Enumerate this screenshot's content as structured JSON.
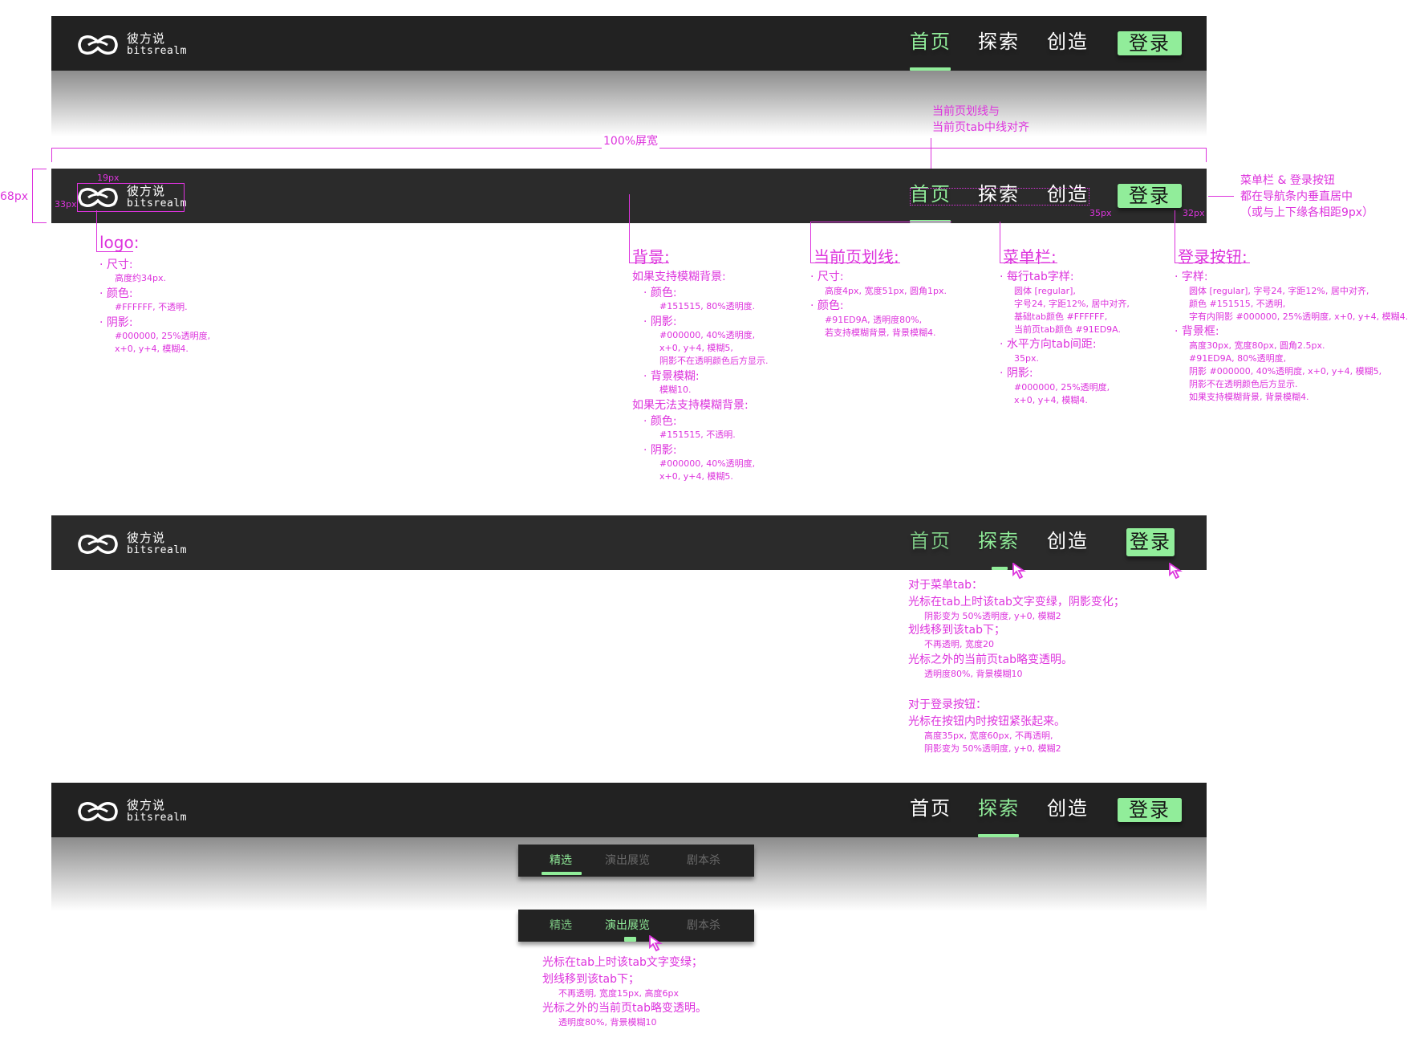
{
  "logo": {
    "cn": "彼方说",
    "en": "bitsrealm"
  },
  "nav": {
    "tabs": [
      "首页",
      "探索",
      "创造"
    ],
    "login": "登录"
  },
  "colors": {
    "accent": "#91ED9A",
    "bar": "#151515",
    "annotation": "#dd33dd"
  },
  "icons": [
    "logo-mask-icon",
    "cursor-icon"
  ],
  "measure": {
    "width_label": "100%屏宽",
    "height_label": "68px",
    "top_label": "19px",
    "left_label": "33px",
    "gap_label": "35px",
    "right_label": "32px"
  },
  "notes": {
    "underline_align": [
      "当前页划线与",
      "当前页tab中线对齐"
    ],
    "vcenter": [
      "菜单栏 & 登录按钮",
      "都在导航条内垂直居中",
      "（或与上下缘各相距9px）"
    ]
  },
  "logo_spec": {
    "title": "logo:",
    "size_t": "· 尺寸:",
    "size_v": "高度约34px.",
    "color_t": "· 颜色:",
    "color_v": "#FFFFFF, 不透明.",
    "shadow_t": "· 阴影:",
    "shadow_v1": "#000000, 25%透明度,",
    "shadow_v2": "x+0, y+4, 模糊4."
  },
  "bg_spec": {
    "title": "背景:",
    "blur_yes": "如果支持模糊背景:",
    "color_t": "· 颜色:",
    "color_v": "#151515, 80%透明度.",
    "shadow_t": "· 阴影:",
    "shadow_v1": "#000000, 40%透明度,",
    "shadow_v2": "x+0, y+4, 模糊5,",
    "shadow_v3": "阴影不在透明颜色后方显示.",
    "blur_t": "· 背景模糊:",
    "blur_v": "模糊10.",
    "blur_no": "如果无法支持模糊背景:",
    "color2_t": "· 颜色:",
    "color2_v": "#151515, 不透明.",
    "shadow2_t": "· 阴影:",
    "shadow2_v1": "#000000, 40%透明度,",
    "shadow2_v2": "x+0, y+4, 模糊5."
  },
  "uline_spec": {
    "title": "当前页划线:",
    "size_t": "· 尺寸:",
    "size_v": "高度4px, 宽度51px, 圆角1px.",
    "color_t": "· 颜色:",
    "color_v1": "#91ED9A, 透明度80%,",
    "color_v2": "若支持模糊背景, 背景模糊4."
  },
  "menu_spec": {
    "title": "菜单栏:",
    "font_t": "· 每行tab字样:",
    "font_v1": "圆体 [regular],",
    "font_v2": "字号24, 字距12%, 居中对齐,",
    "font_v3": "基础tab颜色 #FFFFFF,",
    "font_v4": "当前页tab颜色 #91ED9A.",
    "gap_t": "· 水平方向tab间距:",
    "gap_v": "35px.",
    "shadow_t": "· 阴影:",
    "shadow_v1": "#000000, 25%透明度,",
    "shadow_v2": "x+0, y+4, 模糊4."
  },
  "login_spec": {
    "title": "登录按钮:",
    "font_t": "· 字样:",
    "font_v1": "圆体 [regular], 字号24, 字距12%, 居中对齐,",
    "font_v2": "颜色 #151515, 不透明,",
    "font_v3": "字有内阴影 #000000, 25%透明度, x+0, y+4, 模糊4.",
    "box_t": "· 背景框:",
    "box_v1": "高度30px, 宽度80px, 圆角2.5px.",
    "box_v2": "#91ED9A, 80%透明度,",
    "box_v3": "阴影 #000000, 40%透明度, x+0, y+4, 模糊5,",
    "box_v4": "阴影不在透明颜色后方显示.",
    "box_v5": "如果支持模糊背景, 背景模糊4."
  },
  "hover_spec": {
    "l1": "对于菜单tab：",
    "l2": "光标在tab上时该tab文字变绿，阴影变化；",
    "l3": "阴影变为 50%透明度, y+0, 模糊2",
    "l4": "划线移到该tab下；",
    "l5": "不再透明, 宽度20",
    "l6": "光标之外的当前页tab略变透明。",
    "l7": "透明度80%, 背景模糊10",
    "l8": "对于登录按钮：",
    "l9": "光标在按钮内时按钮紧张起来。",
    "l10": "高度35px, 宽度60px, 不再透明,",
    "l11": "阴影变为 50%透明度, y+0, 模糊2"
  },
  "subnav": {
    "tabs": [
      "精选",
      "演出展览",
      "剧本杀"
    ]
  },
  "sub_hover_spec": {
    "l1": "光标在tab上时该tab文字变绿；",
    "l2": "划线移到该tab下；",
    "l3": "不再透明, 宽度15px, 高度6px",
    "l4": "光标之外的当前页tab略变透明。",
    "l5": "透明度80%, 背景模糊10"
  }
}
